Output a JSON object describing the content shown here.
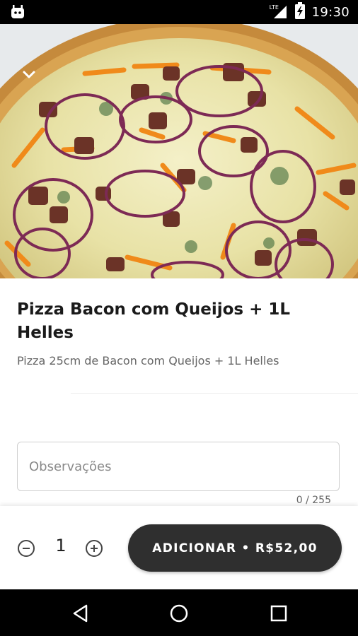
{
  "status_bar": {
    "network_label": "LTE",
    "time": "19:30",
    "icons": [
      "android-icon",
      "lte-signal-icon",
      "battery-charging-icon"
    ]
  },
  "product": {
    "image_alt": "pizza-photo",
    "title": "Pizza Bacon com Queijos + 1L Helles",
    "description": "Pizza 25cm de Bacon com Queijos + 1L Helles"
  },
  "notes": {
    "placeholder": "Observações",
    "value": "",
    "char_count": "0 / 255"
  },
  "cart": {
    "quantity": "1",
    "add_label": "ADICIONAR • R$52,00"
  },
  "colors": {
    "button_bg": "#2f2f2f",
    "status_bar_bg": "#000000",
    "nav_bar_bg": "#000000"
  },
  "navigation": {
    "buttons": [
      "back-icon",
      "home-icon",
      "recents-icon"
    ]
  }
}
